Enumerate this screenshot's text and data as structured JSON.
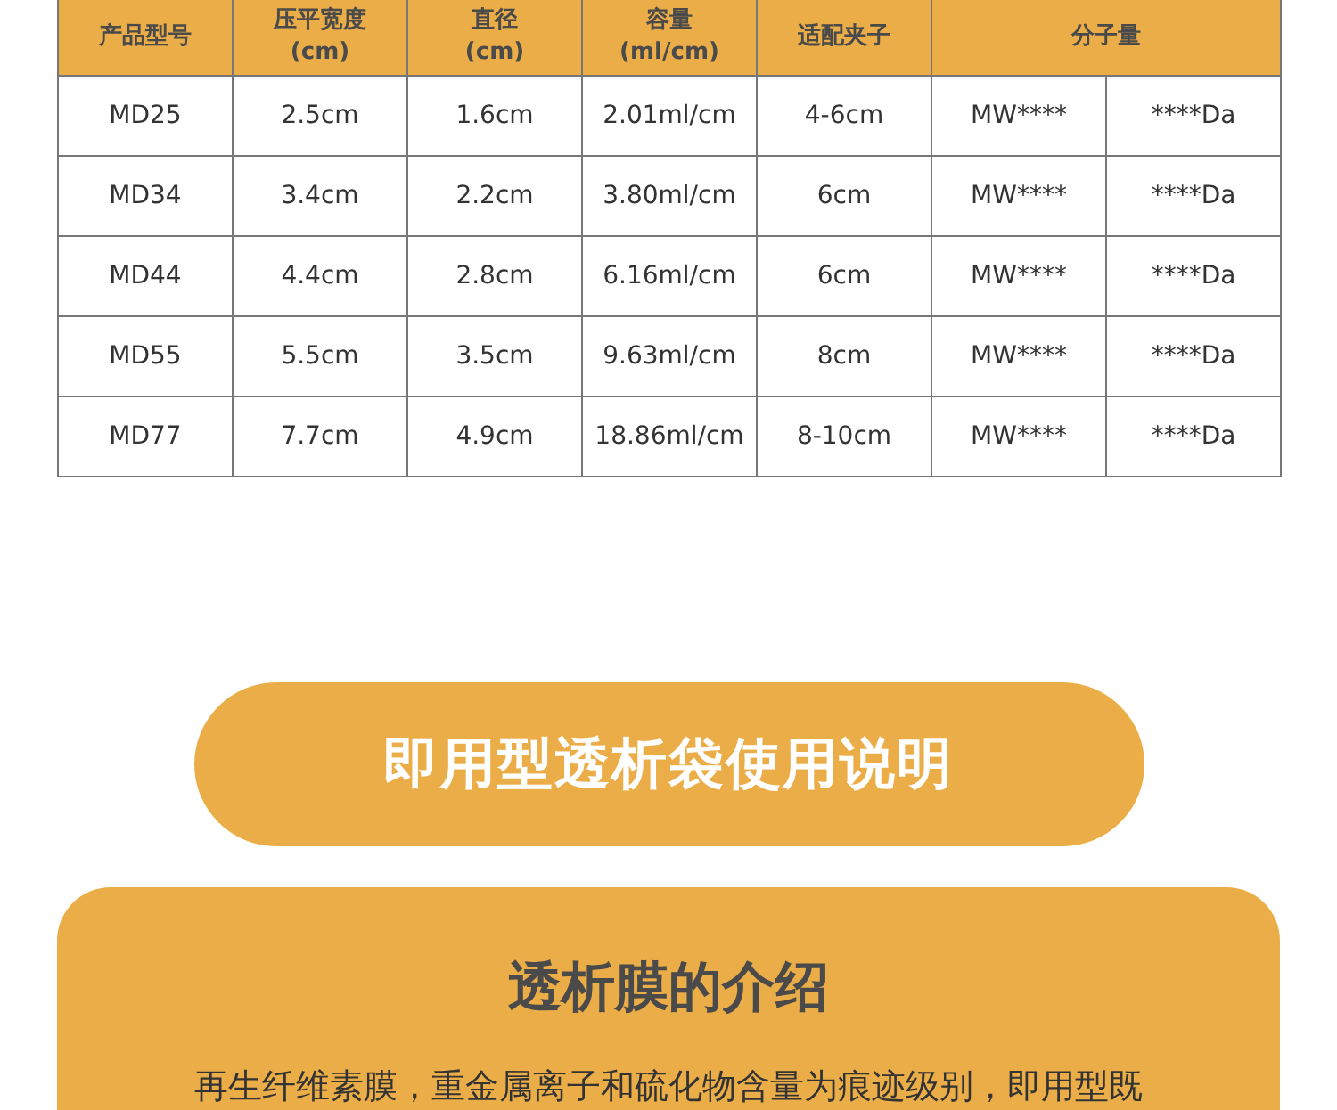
{
  "table": {
    "columns": [
      {
        "label": "产品型号"
      },
      {
        "label": "压平宽度\n(cm)"
      },
      {
        "label": "直径\n(cm)"
      },
      {
        "label": "容量\n(ml/cm)"
      },
      {
        "label": "适配夹子"
      },
      {
        "label": "分子量",
        "colspan": 2
      }
    ],
    "rows": [
      [
        "MD25",
        "2.5cm",
        "1.6cm",
        "2.01ml/cm",
        "4-6cm",
        "MW****",
        "****Da"
      ],
      [
        "MD34",
        "3.4cm",
        "2.2cm",
        "3.80ml/cm",
        "6cm",
        "MW****",
        "****Da"
      ],
      [
        "MD44",
        "4.4cm",
        "2.8cm",
        "6.16ml/cm",
        "6cm",
        "MW****",
        "****Da"
      ],
      [
        "MD55",
        "5.5cm",
        "3.5cm",
        "9.63ml/cm",
        "8cm",
        "MW****",
        "****Da"
      ],
      [
        "MD77",
        "7.7cm",
        "4.9cm",
        "18.86ml/cm",
        "8-10cm",
        "MW****",
        "****Da"
      ]
    ]
  },
  "banner": {
    "title": "即用型透析袋使用说明"
  },
  "section": {
    "title": "透析膜的介绍",
    "text": "再生纤维素膜，重金属离子和硫化物含量为痕迹级别，即用型既"
  }
}
